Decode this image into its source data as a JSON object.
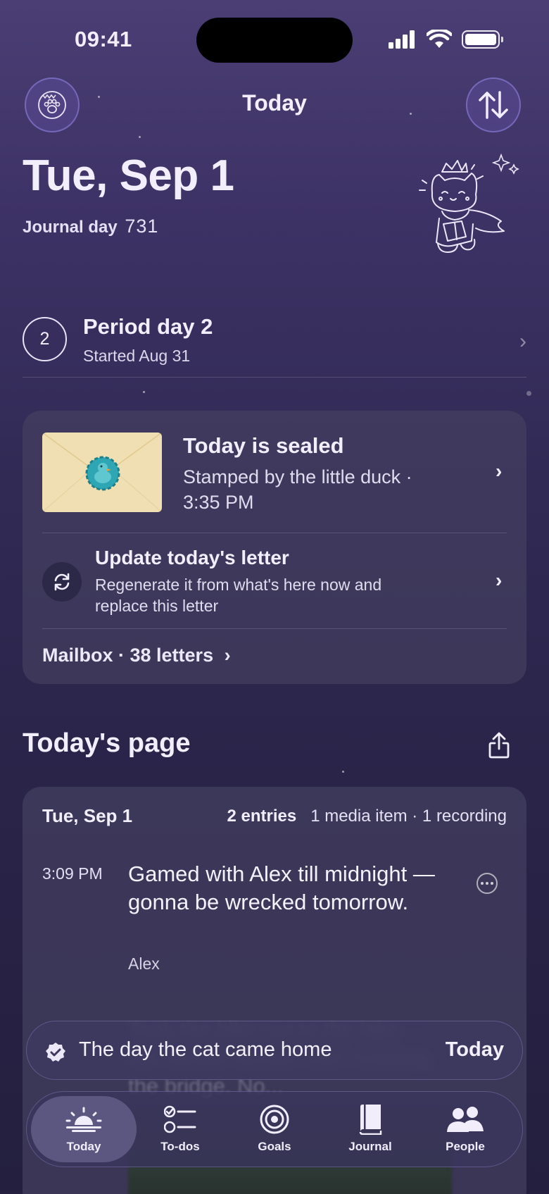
{
  "status_bar": {
    "time": "09:41"
  },
  "header": {
    "title": "Today"
  },
  "date": {
    "display": "Tue, Sep 1",
    "journal_day_label": "Journal day",
    "journal_day_number": "731"
  },
  "period": {
    "badge": "2",
    "title": "Period day 2",
    "subtitle": "Started Aug 31"
  },
  "sealed": {
    "title": "Today is sealed",
    "subtitle": "Stamped by the little duck · 3:35 PM",
    "update_title": "Update today's letter",
    "update_subtitle": "Regenerate it from what's here now and replace this letter",
    "mailbox": "Mailbox · 38 letters"
  },
  "todays_page": {
    "title": "Today's page",
    "date": "Tue, Sep 1",
    "entries_count": "2 entries",
    "media_meta": "1 media item · 1 recording",
    "entry": {
      "time": "3:09 PM",
      "text": "Gamed with Alex till midnight — gonna be wrecked tomorrow.",
      "person": "Alex"
    },
    "next_entry_partial": "Took the bike out to the lake — the sunset turned cool crossing the bridge. No..."
  },
  "banner": {
    "text": "The day the cat came home",
    "action": "Today"
  },
  "tabbar": {
    "items": [
      {
        "label": "Today",
        "icon": "sunrise-icon",
        "active": true
      },
      {
        "label": "To-dos",
        "icon": "checklist-icon",
        "active": false
      },
      {
        "label": "Goals",
        "icon": "target-icon",
        "active": false
      },
      {
        "label": "Journal",
        "icon": "book-icon",
        "active": false
      },
      {
        "label": "People",
        "icon": "people-icon",
        "active": false
      }
    ]
  },
  "colors": {
    "background_top": "#4a3e74",
    "background_bottom": "#241f3e",
    "card": "#444060",
    "envelope": "#f0dfb2",
    "seal": "#2fa6b3"
  }
}
